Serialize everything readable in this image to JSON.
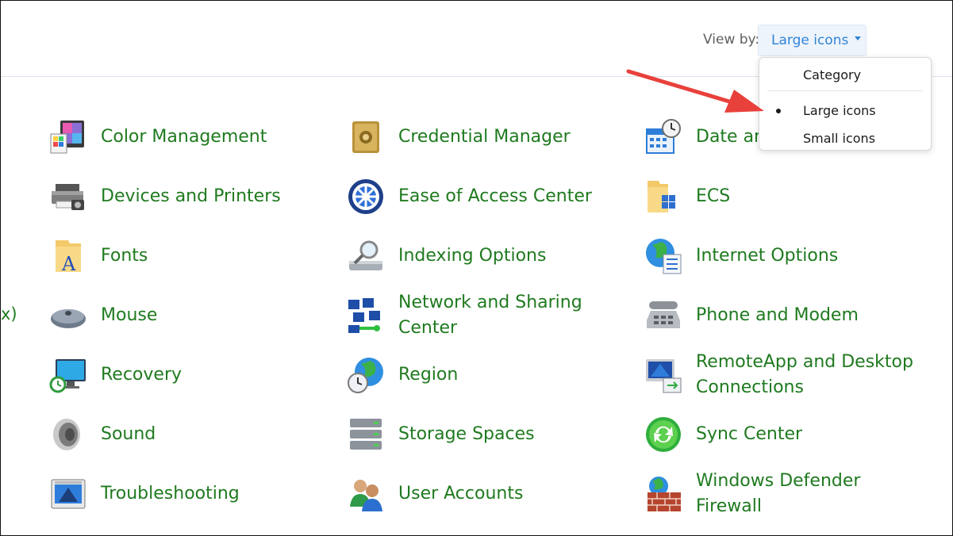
{
  "header": {
    "view_by_label": "View by:",
    "view_by_value": "Large icons"
  },
  "menu": {
    "items": [
      {
        "label": "Category",
        "selected": false
      },
      {
        "label": "Large icons",
        "selected": true
      },
      {
        "label": "Small icons",
        "selected": false
      }
    ]
  },
  "edge_fragment": "x)",
  "columns": [
    [
      {
        "label": "Color Management",
        "icon": "color-management-icon"
      },
      {
        "label": "Devices and Printers",
        "icon": "printer-icon"
      },
      {
        "label": "Fonts",
        "icon": "fonts-folder-icon"
      },
      {
        "label": "Mouse",
        "icon": "mouse-icon"
      },
      {
        "label": "Recovery",
        "icon": "recovery-icon"
      },
      {
        "label": "Sound",
        "icon": "speaker-icon"
      },
      {
        "label": "Troubleshooting",
        "icon": "troubleshooting-icon"
      }
    ],
    [
      {
        "label": "Credential Manager",
        "icon": "credential-safe-icon"
      },
      {
        "label": "Ease of Access Center",
        "icon": "ease-of-access-icon"
      },
      {
        "label": "Indexing Options",
        "icon": "indexing-magnifier-icon"
      },
      {
        "label": "Network and Sharing\nCenter",
        "icon": "network-icon"
      },
      {
        "label": "Region",
        "icon": "region-globe-clock-icon"
      },
      {
        "label": "Storage Spaces",
        "icon": "storage-drives-icon"
      },
      {
        "label": "User Accounts",
        "icon": "users-icon"
      }
    ],
    [
      {
        "label": "Date and Time",
        "icon": "calendar-clock-icon"
      },
      {
        "label": "ECS",
        "icon": "folder-cube-icon"
      },
      {
        "label": "Internet Options",
        "icon": "globe-list-icon"
      },
      {
        "label": "Phone and Modem",
        "icon": "phone-icon"
      },
      {
        "label": "RemoteApp and Desktop\nConnections",
        "icon": "remote-desktop-icon"
      },
      {
        "label": "Sync Center",
        "icon": "sync-icon"
      },
      {
        "label": "Windows Defender\nFirewall",
        "icon": "firewall-icon"
      }
    ]
  ],
  "colors": {
    "link_green": "#1f7a1f",
    "accent_blue": "#2f84d8",
    "annotation_red": "#e8413c"
  }
}
